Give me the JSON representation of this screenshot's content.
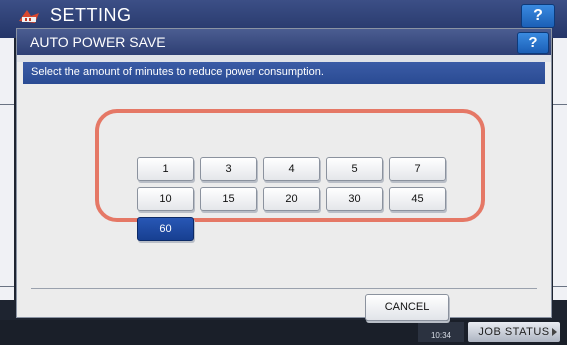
{
  "background": {
    "title": "SETTING",
    "help_label": "?",
    "job_status_label": "JOB STATUS",
    "time": "10:34"
  },
  "dialog": {
    "title": "AUTO POWER SAVE",
    "help_label": "?",
    "instruction": "Select the amount of minutes to reduce power consumption.",
    "minute_options": [
      "1",
      "3",
      "4",
      "5",
      "7",
      "10",
      "15",
      "20",
      "30",
      "45",
      "60"
    ],
    "selected_option": "60",
    "cancel_label": "CANCEL"
  },
  "colors": {
    "accent": "#1f4ba1",
    "highlight_frame": "#e57866",
    "title_bar": "#34457a"
  },
  "icons": {
    "logo": "setting-logo-icon"
  }
}
